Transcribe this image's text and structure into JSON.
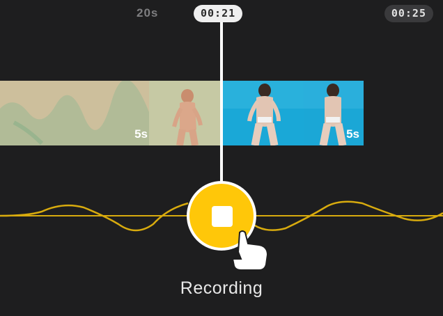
{
  "ruler": {
    "label": "20s"
  },
  "current_time": "00:21",
  "end_time": "00:25",
  "clips": [
    {
      "duration_label": "5s",
      "tint": "#c9bf9a",
      "state": "recorded"
    },
    {
      "duration_label": "5s",
      "tint": "#1aa9d8",
      "state": "upcoming"
    }
  ],
  "record_button": {
    "icon": "stop-icon",
    "color": "#ffc709"
  },
  "status_label": "Recording",
  "colors": {
    "accent": "#ffc709",
    "background": "#1e1e1f",
    "waveform": "#d8ab0e"
  }
}
